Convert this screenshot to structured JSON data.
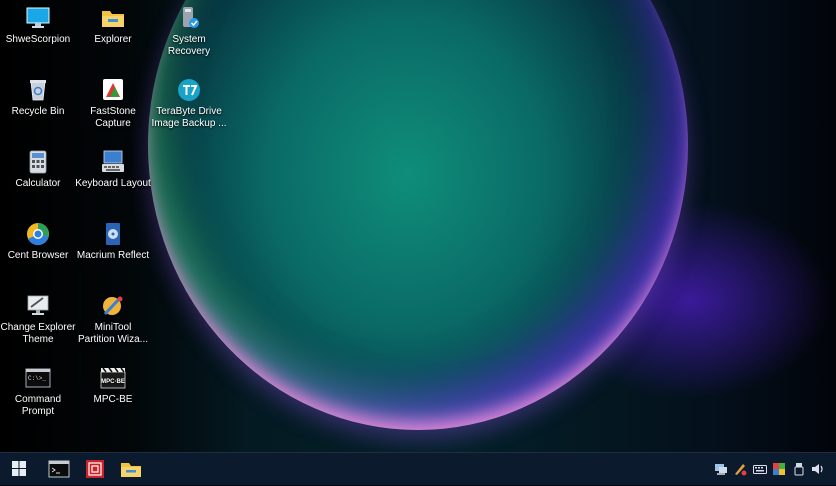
{
  "desktop": {
    "icons": [
      {
        "label": "ShweScorpion",
        "icon": "monitor-icon"
      },
      {
        "label": "Explorer",
        "icon": "folder-icon"
      },
      {
        "label": "System Recovery",
        "icon": "recovery-icon"
      },
      {
        "label": "Recycle Bin",
        "icon": "recycle-bin-icon"
      },
      {
        "label": "FastStone Capture",
        "icon": "faststone-icon"
      },
      {
        "label": "TeraByte Drive Image Backup ...",
        "icon": "terabyte-icon"
      },
      {
        "label": "Calculator",
        "icon": "calculator-icon"
      },
      {
        "label": "Keyboard Layout",
        "icon": "keyboard-icon"
      },
      {
        "label": "Cent Browser",
        "icon": "cent-browser-icon"
      },
      {
        "label": "Macrium Reflect",
        "icon": "macrium-icon"
      },
      {
        "label": "Change Explorer Theme",
        "icon": "theme-icon"
      },
      {
        "label": "MiniTool Partition Wiza...",
        "icon": "minitool-icon"
      },
      {
        "label": "Command Prompt",
        "icon": "cmd-icon"
      },
      {
        "label": "MPC-BE",
        "icon": "mpc-be-icon"
      }
    ],
    "mpc_badge": "MPC·BE",
    "cmd_prompt_text": "C:\\>_"
  },
  "taskbar": {
    "pinned": [
      {
        "name": "start-button",
        "icon": "windows-icon"
      },
      {
        "name": "cmd-taskbar-button",
        "icon": "cmd-icon"
      },
      {
        "name": "app-taskbar-button",
        "icon": "red-app-icon"
      },
      {
        "name": "explorer-taskbar-button",
        "icon": "folder-icon"
      }
    ],
    "tray": [
      "network-icon",
      "pen-icon",
      "keyboard-icon",
      "color-icon",
      "usb-icon",
      "volume-icon"
    ]
  },
  "colors": {
    "taskbar_bg": "#0b1a2c",
    "icon_text": "#ffffff"
  }
}
